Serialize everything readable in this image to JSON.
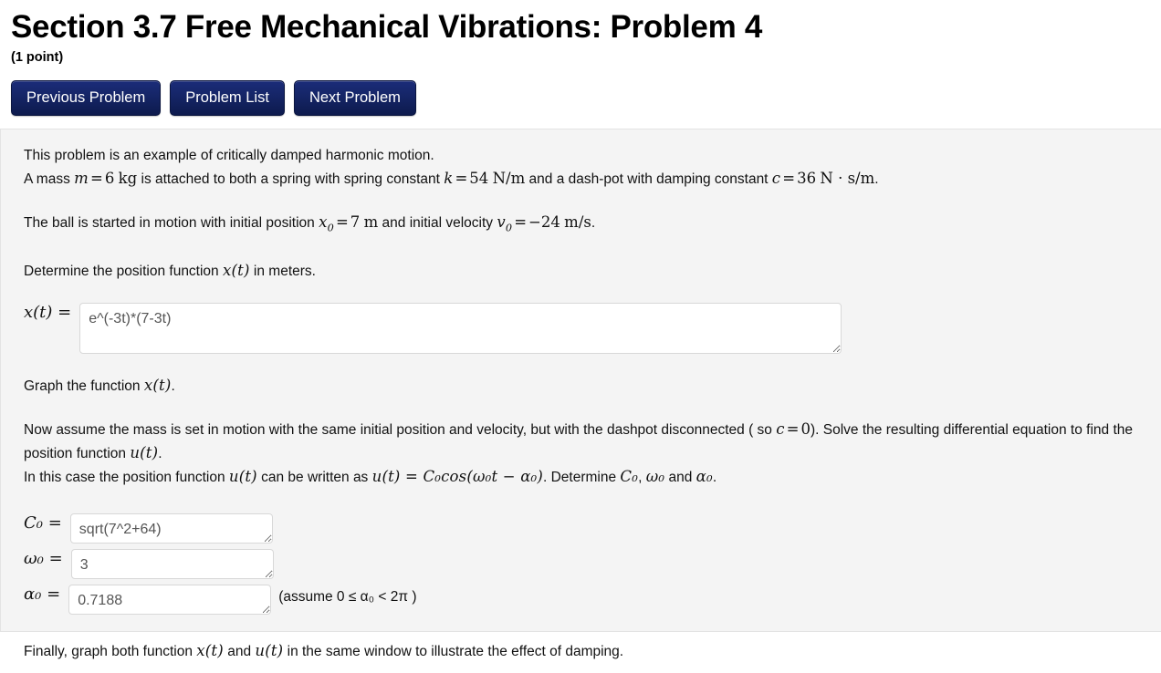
{
  "header": {
    "title": "Section 3.7 Free Mechanical Vibrations: Problem 4",
    "point_value": "(1 point)"
  },
  "nav": {
    "previous_label": "Previous Problem",
    "list_label": "Problem List",
    "next_label": "Next Problem"
  },
  "problem": {
    "intro_line": "This problem is an example of critically damped harmonic motion.",
    "setup": {
      "before_mass": "A mass ",
      "mass_symbol": "m",
      "mass_value": "6",
      "mass_unit": "kg",
      "mid_text": " is attached to both a spring with spring constant ",
      "spring_symbol": "k",
      "spring_value": "54",
      "spring_unit": "N/m",
      "after_spring": " and a dash-pot with damping constant ",
      "damping_symbol": "c",
      "damping_value": "36",
      "damping_unit": "N · s/m",
      "trailing": "."
    },
    "initial": {
      "prefix": "The ball is started in motion with initial position ",
      "x0_symbol": "x",
      "x0_sub": "0",
      "x0_value": "7",
      "x0_unit": "m",
      "middle": " and initial velocity ",
      "v0_symbol": "v",
      "v0_sub": "0",
      "v0_value": "−24",
      "v0_unit": "m/s",
      "suffix": "."
    },
    "determine_prefix": "Determine the position function ",
    "determine_fn": "x(t)",
    "determine_suffix": " in meters.",
    "graph_prefix": "Graph the function ",
    "graph_fn": "x(t)",
    "graph_suffix": ".",
    "dashpot_part1": "Now assume the mass is set in motion with the same initial position and velocity, but with the dashpot disconnected ( so ",
    "dashpot_c": "c",
    "dashpot_eq": "=",
    "dashpot_zero": "0",
    "dashpot_part2": "). Solve the resulting differential equation to find the position function ",
    "dashpot_fn": "u(t)",
    "dashpot_part3": ".",
    "formula_prefix": "In this case the position function ",
    "formula_fn": "u(t)",
    "formula_mid": " can be written as ",
    "formula_expr": "u(t) = C₀cos(ω₀t − α₀)",
    "formula_suffix": ". Determine ",
    "formula_c0": "C₀",
    "formula_comma": ", ",
    "formula_w0": "ω₀",
    "formula_and": " and ",
    "formula_a0": "α₀",
    "formula_end": ".",
    "final_prefix": "Finally, graph both function ",
    "final_fn1": "x(t)",
    "final_mid": " and ",
    "final_fn2": "u(t)",
    "final_suffix": " in the same window to illustrate the effect of damping."
  },
  "answers": {
    "xt": {
      "label": "x(t) =",
      "value": "e^(-3t)*(7-3t)",
      "placeholder": ""
    },
    "c0": {
      "label": "C₀ =",
      "value": "sqrt(7^2+64)",
      "placeholder": ""
    },
    "w0": {
      "label": "ω₀ =",
      "value": "3",
      "placeholder": ""
    },
    "a0": {
      "label": "α₀ =",
      "value": "0.7188",
      "placeholder": "",
      "assume_note": "(assume 0 ≤ α₀ < 2π )"
    }
  },
  "colors": {
    "button_blue": "#152566",
    "panel_bg": "#f4f4f4",
    "input_text": "#555555"
  }
}
